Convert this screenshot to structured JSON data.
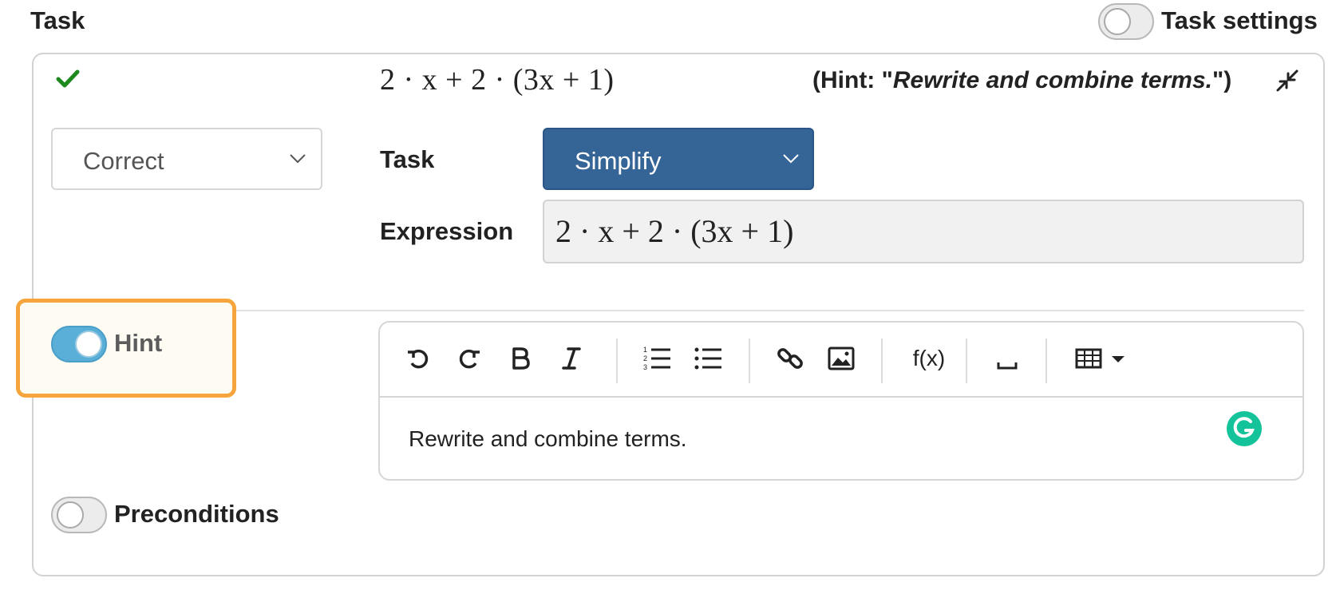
{
  "header": {
    "title": "Task",
    "settings_label": "Task settings"
  },
  "task": {
    "summary_expression": "2 · x + 2 · (3x + 1)",
    "hint_prefix": "(Hint: \"",
    "hint_text": "Rewrite and combine terms.",
    "hint_suffix": "\")",
    "status": "Correct",
    "task_label": "Task",
    "task_type": "Simplify",
    "expression_label": "Expression",
    "expression": "2 · x + 2 · (3x + 1)"
  },
  "hint": {
    "label": "Hint",
    "enabled": true,
    "editor_text": "Rewrite and combine terms."
  },
  "preconditions": {
    "label": "Preconditions",
    "enabled": false
  },
  "toolbar": {
    "fx_label": "f(x)",
    "buttons": [
      "undo-icon",
      "redo-icon",
      "bold-icon",
      "italic-icon",
      "numbered-list-icon",
      "bulleted-list-icon",
      "link-icon",
      "image-icon",
      "formula",
      "space-icon",
      "table-icon"
    ]
  },
  "colors": {
    "accent_select": "#356497",
    "check": "#1e8a1e",
    "highlight": "#f6a53c",
    "toggle_on": "#5aafd8",
    "grammarly": "#15c39a"
  }
}
